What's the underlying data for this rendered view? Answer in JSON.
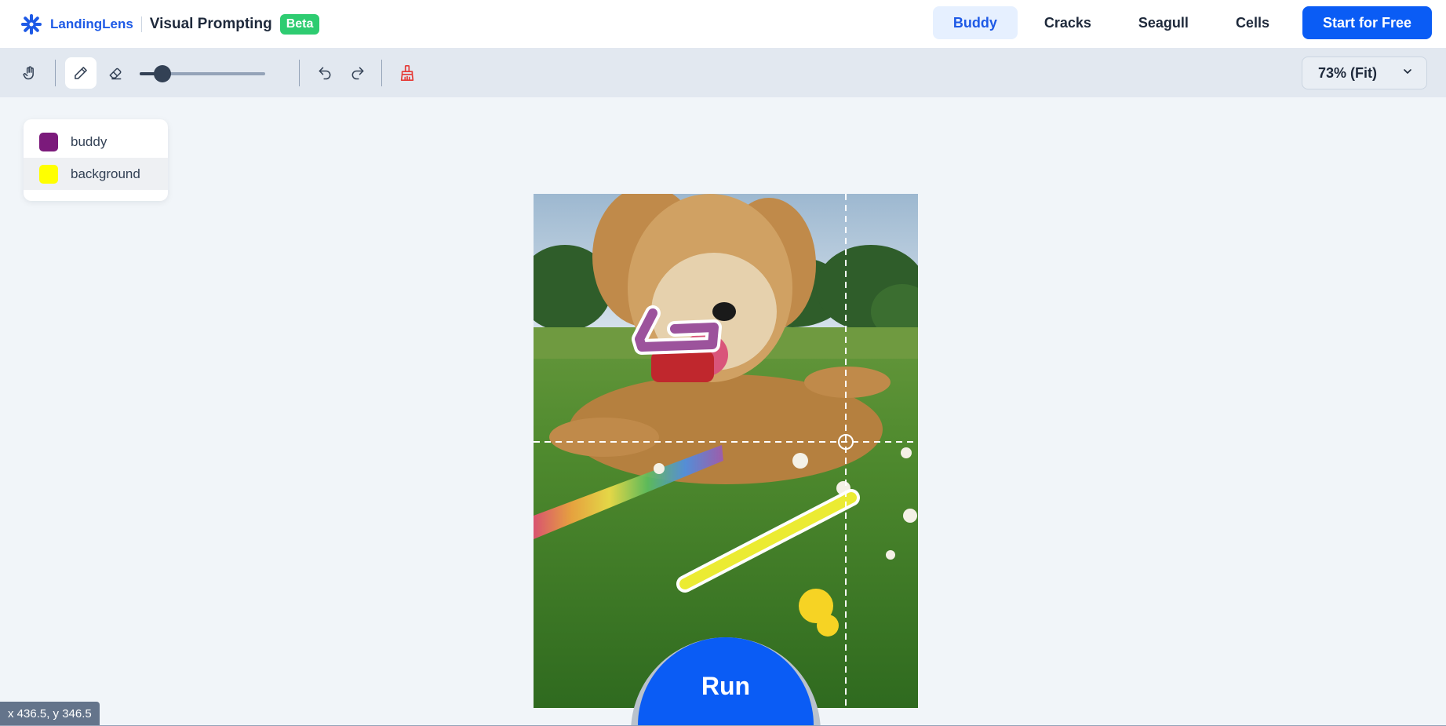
{
  "brand": {
    "logo": "landinglens-logo-icon",
    "name": "LandingLens",
    "product": "Visual Prompting",
    "badge": "Beta"
  },
  "nav": {
    "tabs": [
      {
        "label": "Buddy",
        "active": true
      },
      {
        "label": "Cracks",
        "active": false
      },
      {
        "label": "Seagull",
        "active": false
      },
      {
        "label": "Cells",
        "active": false
      }
    ],
    "cta": "Start for Free"
  },
  "toolbar": {
    "tools": [
      "hand-pan-icon",
      "pencil-icon",
      "eraser-icon",
      "undo-icon",
      "redo-icon",
      "clear-brush-icon"
    ],
    "active_tool": "pencil-icon",
    "brush_size_fraction": 0.18,
    "zoom": "73% (Fit)"
  },
  "classes": [
    {
      "label": "buddy",
      "color": "#7b1a7b"
    },
    {
      "label": "background",
      "color": "#ffff00",
      "selected": true
    }
  ],
  "run_label": "Run",
  "cursor_coords": "x 436.5, y 346.5",
  "colors": {
    "accent": "#0a5cf5",
    "beta": "#2ecc71",
    "buddy": "#7b1a7b",
    "background_class": "#ffff00"
  }
}
